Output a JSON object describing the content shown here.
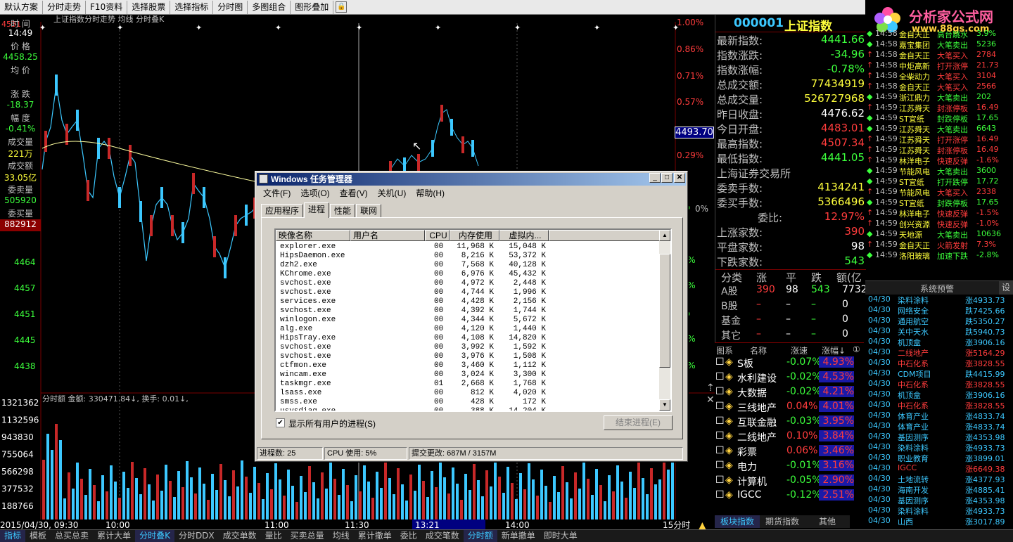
{
  "toolbar": {
    "items": [
      "默认方案",
      "分时走势",
      "F10资料",
      "选择股票",
      "选择指标",
      "分时图",
      "多图组合",
      "图形叠加"
    ],
    "lock_icon": "lock-icon"
  },
  "chart": {
    "header": "上证指数分时走势  均线  分时叠K",
    "left_top_value": "4531",
    "left_panel": {
      "time_label": "时 间",
      "time": "14:49",
      "price_label": "价 格",
      "price": "4458.25",
      "avg_label": "均 价",
      "change_label": "涨 跌",
      "change": "-18.37",
      "pct_label": "幅 度",
      "pct": "-0.41%",
      "vol_label": "成交量",
      "vol": "221万",
      "amt_label": "成交额",
      "amt": "33.05亿",
      "sell_label": "委卖量",
      "sell": "505920",
      "buy_label": "委买量",
      "buy": "882912"
    },
    "y_axis_left": [
      "4464",
      "4457",
      "4451",
      "4445",
      "4438"
    ],
    "y_axis_right": [
      "1.00%",
      "0.86%",
      "0.71%",
      "0.57%",
      "0.43%",
      "0.29%",
      "0.14%",
      "0.00%",
      "-0.14%",
      "-0.29%",
      "-0.43%",
      "-0.57%",
      "-0.71%",
      "-0.86%"
    ],
    "y_axis_right_visible": [
      "1.00%",
      "0.86%",
      "0.71%",
      "0.57%",
      "0.29%",
      "%",
      "0%",
      "4%",
      "29%",
      "13%",
      "1%",
      "71%",
      "36%"
    ],
    "price_tag": "4493.70",
    "volume_header": "分时额 金额: 330471.84↓, 换手: 0.01↓,",
    "volume_axis": [
      "1321362",
      "1132596",
      "943830",
      "755064",
      "566298",
      "377532",
      "188766"
    ],
    "x_axis": [
      "2015/04/30, 09:30",
      "10:00",
      "11:00",
      "11:30",
      "13:21",
      "14:00",
      "15分时"
    ],
    "right_numbers": [
      "1.00%",
      "0.86%",
      "0.71%",
      "0.57%",
      "0.43%",
      "0.29%",
      "0.14%",
      "0%",
      "4%",
      "1%",
      "71%",
      "36%",
      "13%",
      "29%"
    ]
  },
  "quote": {
    "code": "000001",
    "name": "上证指数",
    "rows": [
      {
        "label": "最新指数:",
        "value": "4441.66",
        "color": "green"
      },
      {
        "label": "指数涨跌:",
        "value": "-34.96",
        "color": "green"
      },
      {
        "label": "指数涨幅:",
        "value": "-0.78%",
        "color": "green"
      },
      {
        "label": "总成交额:",
        "value": "77434919",
        "color": "yellow"
      },
      {
        "label": "总成交量:",
        "value": "526727968",
        "color": "yellow"
      },
      {
        "label": "昨日收盘:",
        "value": "4476.62",
        "color": "white"
      },
      {
        "label": "今日开盘:",
        "value": "4483.01",
        "color": "red"
      },
      {
        "label": "最高指数:",
        "value": "4507.34",
        "color": "red"
      },
      {
        "label": "最低指数:",
        "value": "4441.05",
        "color": "green"
      }
    ],
    "exchange": "上海证券交易所",
    "rows2": [
      {
        "label": "委卖手数:",
        "value": "4134241",
        "color": "yellow"
      },
      {
        "label": "委买手数:",
        "value": "5366496",
        "color": "yellow"
      },
      {
        "label": "委比:",
        "value": "12.97%",
        "color": "red"
      },
      {
        "label": "上涨家数:",
        "value": "390",
        "color": "red"
      },
      {
        "label": "平盘家数:",
        "value": "98",
        "color": "white"
      },
      {
        "label": "下跌家数:",
        "value": "543",
        "color": "green"
      }
    ],
    "dist_head": [
      "分类",
      "涨",
      "平",
      "跌",
      "额(亿"
    ],
    "dist_rows": [
      {
        "name": "A股",
        "up": "390",
        "flat": "98",
        "down": "543",
        "amt": "7732"
      },
      {
        "name": "B股",
        "up": "–",
        "flat": "–",
        "down": "–",
        "amt": "0"
      },
      {
        "name": "基金",
        "up": "–",
        "flat": "–",
        "down": "–",
        "amt": "0"
      },
      {
        "name": "其它",
        "up": "–",
        "flat": "–",
        "down": "–",
        "amt": "0"
      }
    ]
  },
  "blocks": {
    "head": [
      "图系",
      "名称",
      "涨速",
      "涨幅↓",
      "①"
    ],
    "rows": [
      {
        "name": "S板",
        "speed": "-0.07%",
        "pct": "4.93%"
      },
      {
        "name": "水利建设",
        "speed": "-0.02%",
        "pct": "4.53%"
      },
      {
        "name": "大数据",
        "speed": "-0.02%",
        "pct": "4.21%"
      },
      {
        "name": "三线地产",
        "speed": "0.04%",
        "pct": "4.01%"
      },
      {
        "name": "互联金融",
        "speed": "-0.03%",
        "pct": "3.95%"
      },
      {
        "name": "二线地产",
        "speed": "0.10%",
        "pct": "3.84%"
      },
      {
        "name": "彩票",
        "speed": "0.06%",
        "pct": "3.46%"
      },
      {
        "name": "电力",
        "speed": "-0.01%",
        "pct": "3.16%"
      },
      {
        "name": "计算机",
        "speed": "-0.05%",
        "pct": "2.90%"
      },
      {
        "name": "IGCC",
        "speed": "-0.12%",
        "pct": "2.51%"
      }
    ],
    "tabs": [
      "板块指数",
      "期货指数",
      "其他"
    ],
    "bottom_tabs": [
      "分笔",
      "成本",
      "短线",
      "成份",
      "相关",
      "附图",
      "市场"
    ]
  },
  "logo": {
    "title": "分析家公式网",
    "url": "www.88gs.com"
  },
  "tape": [
    {
      "t": "14:58",
      "n": "金自天正",
      "a": "高台跳水",
      "v": "3.9%",
      "c": "green"
    },
    {
      "t": "14:58",
      "n": "嘉宝集团",
      "a": "大笔卖出",
      "v": "5236",
      "c": "green"
    },
    {
      "t": "14:58",
      "n": "金自天正",
      "a": "大笔买入",
      "v": "2784",
      "c": "red"
    },
    {
      "t": "14:58",
      "n": "中炬高新",
      "a": "打开涨停",
      "v": "21.73",
      "c": "red"
    },
    {
      "t": "14:58",
      "n": "全柴动力",
      "a": "大笔买入",
      "v": "3104",
      "c": "red"
    },
    {
      "t": "14:58",
      "n": "金自天正",
      "a": "大笔买入",
      "v": "2566",
      "c": "red"
    },
    {
      "t": "14:59",
      "n": "浙江鼎力",
      "a": "大笔卖出",
      "v": "202",
      "c": "green"
    },
    {
      "t": "14:59",
      "n": "江苏舜天",
      "a": "封涨停板",
      "v": "16.49",
      "c": "red"
    },
    {
      "t": "14:59",
      "n": "ST宜纸",
      "a": "封跌停板",
      "v": "17.65",
      "c": "green"
    },
    {
      "t": "14:59",
      "n": "江苏舜天",
      "a": "大笔卖出",
      "v": "6643",
      "c": "green"
    },
    {
      "t": "14:59",
      "n": "江苏舜天",
      "a": "打开涨停",
      "v": "16.49",
      "c": "red"
    },
    {
      "t": "14:59",
      "n": "江苏舜天",
      "a": "封涨停板",
      "v": "16.49",
      "c": "red"
    },
    {
      "t": "14:59",
      "n": "林洋电子",
      "a": "快速反弹",
      "v": "-1.6%",
      "c": "red"
    },
    {
      "t": "14:59",
      "n": "节能风电",
      "a": "大笔卖出",
      "v": "3600",
      "c": "green"
    },
    {
      "t": "14:59",
      "n": "ST宜纸",
      "a": "打开跌停",
      "v": "17.72",
      "c": "green"
    },
    {
      "t": "14:59",
      "n": "节能风电",
      "a": "大笔买入",
      "v": "2338",
      "c": "red"
    },
    {
      "t": "14:59",
      "n": "ST宜纸",
      "a": "封跌停板",
      "v": "17.65",
      "c": "green"
    },
    {
      "t": "14:59",
      "n": "林洋电子",
      "a": "快速反弹",
      "v": "-1.5%",
      "c": "red"
    },
    {
      "t": "14:59",
      "n": "创兴资源",
      "a": "快速反弹",
      "v": "-1.0%",
      "c": "red"
    },
    {
      "t": "14:59",
      "n": "天地源",
      "a": "大笔卖出",
      "v": "10636",
      "c": "green"
    },
    {
      "t": "14:59",
      "n": "金自天正",
      "a": "火箭发射",
      "v": "7.3%",
      "c": "red"
    },
    {
      "t": "14:59",
      "n": "洛阳玻璃",
      "a": "加速下跌",
      "v": "-2.8%",
      "c": "green"
    }
  ],
  "alert": {
    "title": "系统预警",
    "settings": "设",
    "rows": [
      {
        "d": "04/30",
        "n": "染料涂料",
        "v": "涨4933.73",
        "c": "cyan"
      },
      {
        "d": "04/30",
        "n": "网络安全",
        "v": "跌7425.66",
        "c": "cyan"
      },
      {
        "d": "04/30",
        "n": "通用航空",
        "v": "跌5350.27",
        "c": "cyan"
      },
      {
        "d": "04/30",
        "n": "关中天水",
        "v": "跌5940.73",
        "c": "cyan"
      },
      {
        "d": "04/30",
        "n": "机顶盒",
        "v": "涨3906.16",
        "c": "cyan"
      },
      {
        "d": "04/30",
        "n": "二线地产",
        "v": "涨5164.29",
        "c": "red"
      },
      {
        "d": "04/30",
        "n": "中石化系",
        "v": "涨3828.55",
        "c": "red"
      },
      {
        "d": "04/30",
        "n": "CDM项目",
        "v": "跌4415.99",
        "c": "cyan"
      },
      {
        "d": "04/30",
        "n": "中石化系",
        "v": "涨3828.55",
        "c": "red"
      },
      {
        "d": "04/30",
        "n": "机顶盒",
        "v": "涨3906.16",
        "c": "cyan"
      },
      {
        "d": "04/30",
        "n": "中石化系",
        "v": "涨3828.55",
        "c": "red"
      },
      {
        "d": "04/30",
        "n": "体育产业",
        "v": "涨4833.74",
        "c": "cyan"
      },
      {
        "d": "04/30",
        "n": "体育产业",
        "v": "涨4833.74",
        "c": "cyan"
      },
      {
        "d": "04/30",
        "n": "基因测序",
        "v": "涨4353.98",
        "c": "cyan"
      },
      {
        "d": "04/30",
        "n": "染料涂料",
        "v": "涨4933.73",
        "c": "cyan"
      },
      {
        "d": "04/30",
        "n": "职业教育",
        "v": "涨3899.01",
        "c": "cyan"
      },
      {
        "d": "04/30",
        "n": "IGCC",
        "v": "涨6649.38",
        "c": "red"
      },
      {
        "d": "04/30",
        "n": "土地流转",
        "v": "涨4377.93",
        "c": "cyan"
      },
      {
        "d": "04/30",
        "n": "海南开发",
        "v": "涨4885.41",
        "c": "cyan"
      },
      {
        "d": "04/30",
        "n": "基因测序",
        "v": "涨4353.98",
        "c": "cyan"
      },
      {
        "d": "04/30",
        "n": "染料涂料",
        "v": "涨4933.73",
        "c": "cyan"
      },
      {
        "d": "04/30",
        "n": "山西",
        "v": "涨3017.89",
        "c": "cyan"
      }
    ],
    "bottom_tabs": [
      "预警",
      "相关"
    ]
  },
  "bottombar": [
    "指标",
    "模板",
    "总买总卖",
    "累计大单",
    "分时叠K",
    "分时DDX",
    "成交单数",
    "量比",
    "买卖总量",
    "均线",
    "累计撤单",
    "委比",
    "成交笔数",
    "分时额",
    "新单撤单",
    "即时大单"
  ],
  "bottombar_active": [
    0,
    4,
    13
  ],
  "taskmgr": {
    "title": "Windows 任务管理器",
    "menu": [
      "文件(F)",
      "选项(O)",
      "查看(V)",
      "关机(U)",
      "帮助(H)"
    ],
    "tabs": [
      "应用程序",
      "进程",
      "性能",
      "联网"
    ],
    "selected_tab": 1,
    "columns": [
      "映像名称",
      "用户名",
      "CPU",
      "内存使用",
      "虚拟内..."
    ],
    "processes": [
      {
        "name": "explorer.exe",
        "cpu": "00",
        "mem": "11,968 K",
        "vm": "15,048 K"
      },
      {
        "name": "HipsDaemon.exe",
        "cpu": "00",
        "mem": "8,216 K",
        "vm": "53,372 K"
      },
      {
        "name": "dzh2.exe",
        "cpu": "00",
        "mem": "7,568 K",
        "vm": "40,128 K"
      },
      {
        "name": "KChrome.exe",
        "cpu": "00",
        "mem": "6,976 K",
        "vm": "45,432 K"
      },
      {
        "name": "svchost.exe",
        "cpu": "00",
        "mem": "4,972 K",
        "vm": "2,448 K"
      },
      {
        "name": "svchost.exe",
        "cpu": "00",
        "mem": "4,744 K",
        "vm": "1,996 K"
      },
      {
        "name": "services.exe",
        "cpu": "00",
        "mem": "4,428 K",
        "vm": "2,156 K"
      },
      {
        "name": "svchost.exe",
        "cpu": "00",
        "mem": "4,392 K",
        "vm": "1,744 K"
      },
      {
        "name": "winlogon.exe",
        "cpu": "00",
        "mem": "4,344 K",
        "vm": "5,672 K"
      },
      {
        "name": "alg.exe",
        "cpu": "00",
        "mem": "4,120 K",
        "vm": "1,440 K"
      },
      {
        "name": "HipsTray.exe",
        "cpu": "00",
        "mem": "4,108 K",
        "vm": "14,820 K"
      },
      {
        "name": "svchost.exe",
        "cpu": "00",
        "mem": "3,992 K",
        "vm": "1,592 K"
      },
      {
        "name": "svchost.exe",
        "cpu": "00",
        "mem": "3,976 K",
        "vm": "1,508 K"
      },
      {
        "name": "ctfmon.exe",
        "cpu": "00",
        "mem": "3,460 K",
        "vm": "1,112 K"
      },
      {
        "name": "wincam.exe",
        "cpu": "00",
        "mem": "3,024 K",
        "vm": "3,300 K"
      },
      {
        "name": "taskmgr.exe",
        "cpu": "01",
        "mem": "2,668 K",
        "vm": "1,768 K"
      },
      {
        "name": "lsass.exe",
        "cpu": "00",
        "mem": "812 K",
        "vm": "4,020 K"
      },
      {
        "name": "smss.exe",
        "cpu": "00",
        "mem": "428 K",
        "vm": "172 K"
      },
      {
        "name": "usysdiag.exe",
        "cpu": "00",
        "mem": "388 K",
        "vm": "14,204 K"
      }
    ],
    "show_all_label": "显示所有用户的进程(S)",
    "end_process": "结束进程(E)",
    "status": [
      "进程数: 25",
      "CPU 使用: 5%",
      "提交更改: 687M / 3157M"
    ]
  }
}
